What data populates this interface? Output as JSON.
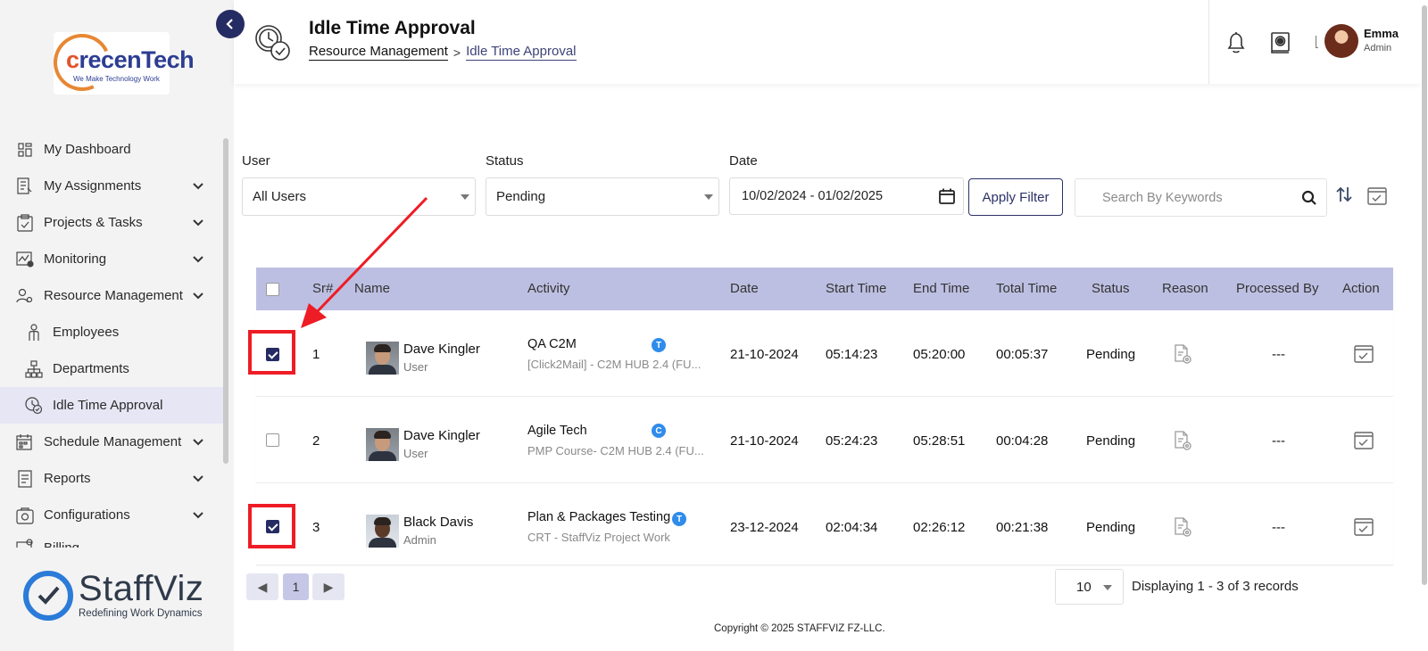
{
  "sidebar": {
    "logo": {
      "text_c": "c",
      "text_rest": "recenTech",
      "tagline": "We Make Technology Work"
    },
    "items": [
      {
        "label": "My Dashboard",
        "icon": "dashboard-icon",
        "expandable": false
      },
      {
        "label": "My Assignments",
        "icon": "assignments-icon",
        "expandable": true
      },
      {
        "label": "Projects & Tasks",
        "icon": "clipboard-icon",
        "expandable": true
      },
      {
        "label": "Monitoring",
        "icon": "monitoring-icon",
        "expandable": true
      },
      {
        "label": "Resource Management",
        "icon": "resource-icon",
        "expandable": true
      },
      {
        "label": "Employees",
        "icon": "employee-icon",
        "sub": true
      },
      {
        "label": "Departments",
        "icon": "departments-icon",
        "sub": true
      },
      {
        "label": "Idle Time Approval",
        "icon": "idle-clock-icon",
        "sub": true,
        "active": true
      },
      {
        "label": "Schedule Management",
        "icon": "schedule-icon",
        "expandable": true
      },
      {
        "label": "Reports",
        "icon": "reports-icon",
        "expandable": true
      },
      {
        "label": "Configurations",
        "icon": "configurations-icon",
        "expandable": true
      },
      {
        "label": "Billing",
        "icon": "billing-icon",
        "expandable": false
      }
    ],
    "brand": {
      "name": "StaffViz",
      "tagline": "Redefining Work Dynamics"
    }
  },
  "header": {
    "title": "Idle Time Approval",
    "breadcrumb": [
      "Resource Management",
      "Idle Time Approval"
    ],
    "breadcrumb_sep": ">",
    "user": {
      "name": "Emma",
      "role": "Admin"
    }
  },
  "filters": {
    "user_label": "User",
    "user_value": "All Users",
    "status_label": "Status",
    "status_value": "Pending",
    "date_label": "Date",
    "date_value": "10/02/2024 - 01/02/2025",
    "apply_label": "Apply Filter",
    "search_placeholder": "Search By Keywords"
  },
  "table": {
    "columns": [
      "Sr#",
      "Name",
      "Activity",
      "Date",
      "Start Time",
      "End Time",
      "Total Time",
      "Status",
      "Reason",
      "Processed By",
      "Action"
    ],
    "rows": [
      {
        "checked": true,
        "sr": "1",
        "name": "Dave Kingler",
        "role": "User",
        "activity": "QA C2M",
        "activity_sub": "[Click2Mail] - C2M HUB 2.4 (FU...",
        "badge": "T",
        "date": "21-10-2024",
        "start": "05:14:23",
        "end": "05:20:00",
        "total": "00:05:37",
        "status": "Pending",
        "processed_by": "---"
      },
      {
        "checked": false,
        "sr": "2",
        "name": "Dave Kingler",
        "role": "User",
        "activity": "Agile Tech",
        "activity_sub": "PMP Course- C2M HUB 2.4 (FU...",
        "badge": "C",
        "date": "21-10-2024",
        "start": "05:24:23",
        "end": "05:28:51",
        "total": "00:04:28",
        "status": "Pending",
        "processed_by": "---"
      },
      {
        "checked": true,
        "sr": "3",
        "name": "Black Davis",
        "role": "Admin",
        "activity": "Plan & Packages Testing",
        "activity_sub": "CRT - StaffViz Project Work",
        "badge": "T",
        "date": "23-12-2024",
        "start": "02:04:34",
        "end": "02:26:12",
        "total": "00:21:38",
        "status": "Pending",
        "processed_by": "---"
      }
    ]
  },
  "pagination": {
    "prev": "◀",
    "current_page": "1",
    "next": "▶",
    "per_page": "10",
    "records_text": "Displaying 1 - 3 of 3 records"
  },
  "footer": {
    "copyright": "Copyright © 2025 STAFFVIZ FZ-LLC."
  },
  "colors": {
    "primary": "#252c63",
    "table_header": "#bdbfe2",
    "highlight": "#ee1c25",
    "badge": "#2f8ceb",
    "active_nav": "#e6e6f5"
  }
}
